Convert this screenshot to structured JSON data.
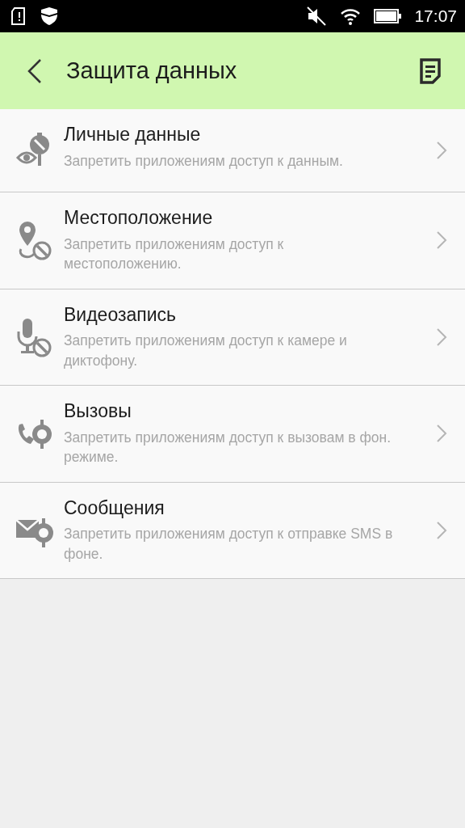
{
  "status_bar": {
    "time": "17:07"
  },
  "header": {
    "title": "Защита данных"
  },
  "items": [
    {
      "title": "Личные данные",
      "description": "Запретить приложениям доступ к данным."
    },
    {
      "title": "Местоположение",
      "description": "Запретить приложениям доступ к местоположению."
    },
    {
      "title": "Видеозапись",
      "description": "Запретить приложениям доступ к камере и диктофону."
    },
    {
      "title": "Вызовы",
      "description": "Запретить приложениям доступ к вызовам в фон. режиме."
    },
    {
      "title": "Сообщения",
      "description": "Запретить приложениям доступ к отправке SMS в фоне."
    }
  ]
}
